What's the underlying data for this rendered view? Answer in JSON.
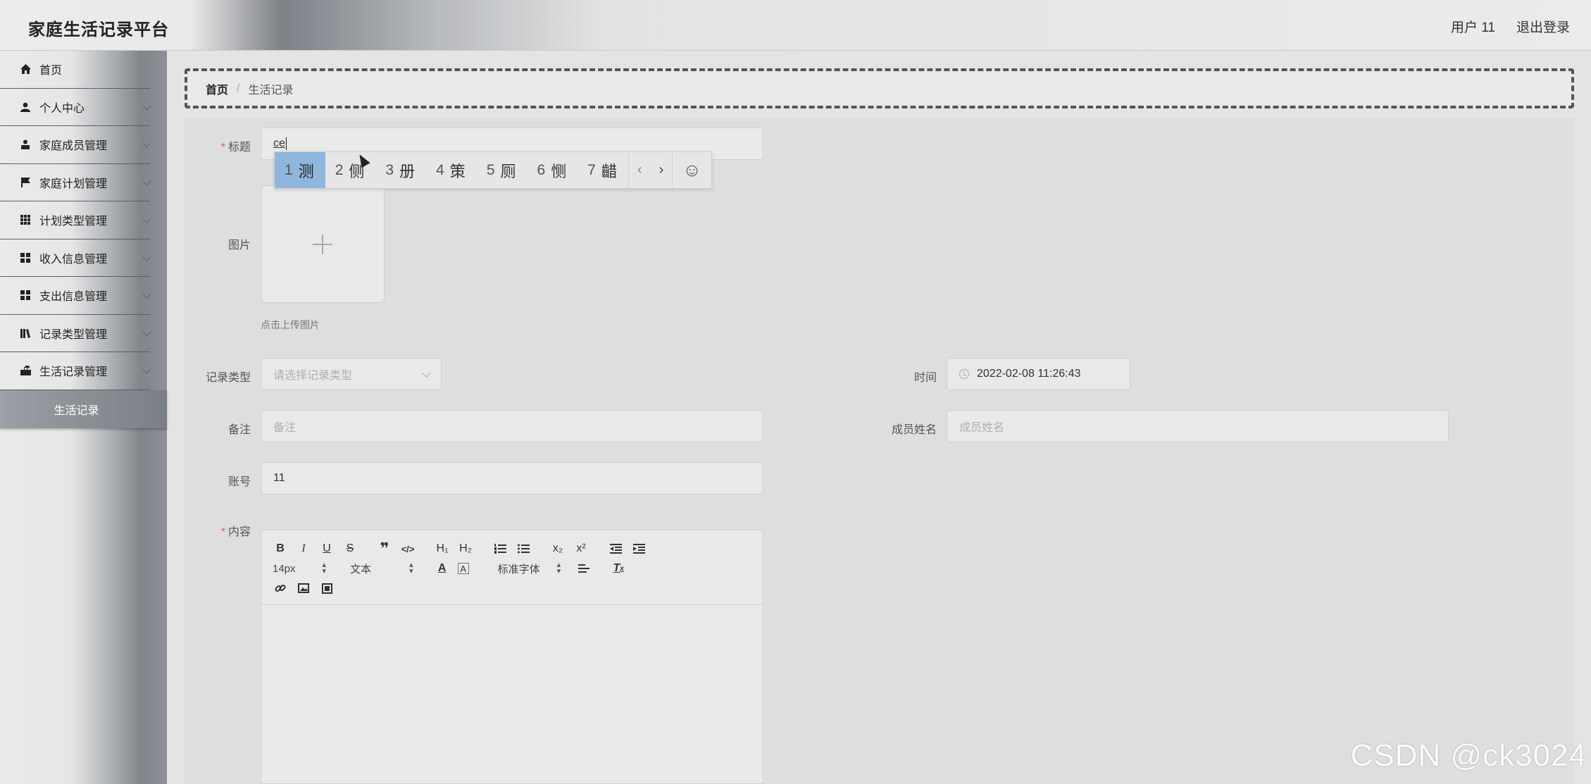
{
  "header": {
    "title": "家庭生活记录平台",
    "user": "用户 11",
    "logout": "退出登录"
  },
  "sidebar": {
    "items": [
      {
        "label": "首页",
        "icon": "home-icon"
      },
      {
        "label": "个人中心",
        "icon": "user-icon"
      },
      {
        "label": "家庭成员管理",
        "icon": "person-icon"
      },
      {
        "label": "家庭计划管理",
        "icon": "flag-icon"
      },
      {
        "label": "计划类型管理",
        "icon": "grid-icon"
      },
      {
        "label": "收入信息管理",
        "icon": "apps-icon"
      },
      {
        "label": "支出信息管理",
        "icon": "apps-icon"
      },
      {
        "label": "记录类型管理",
        "icon": "books-icon"
      },
      {
        "label": "生活记录管理",
        "icon": "briefcase-icon"
      }
    ],
    "active_sub": "生活记录"
  },
  "breadcrumb": {
    "home": "首页",
    "separator": "/",
    "current": "生活记录"
  },
  "form": {
    "title_label": "标题",
    "title_value": "ce",
    "image_label": "图片",
    "upload_tip": "点击上传图片",
    "record_type_label": "记录类型",
    "record_type_placeholder": "请选择记录类型",
    "time_label": "时间",
    "time_value": "2022-02-08 11:26:43",
    "remark_label": "备注",
    "remark_placeholder": "备注",
    "member_label": "成员姓名",
    "member_placeholder": "成员姓名",
    "account_label": "账号",
    "account_value": "11",
    "content_label": "内容"
  },
  "ime": {
    "candidates": [
      {
        "num": "1",
        "text": "测"
      },
      {
        "num": "2",
        "text": "侧"
      },
      {
        "num": "3",
        "text": "册"
      },
      {
        "num": "4",
        "text": "策"
      },
      {
        "num": "5",
        "text": "厕"
      },
      {
        "num": "6",
        "text": "恻"
      },
      {
        "num": "7",
        "text": "齰"
      }
    ],
    "prev": "‹",
    "next": "›",
    "emoji": "☺"
  },
  "editor": {
    "font_size": "14px",
    "format": "文本",
    "font_family": "标准字体",
    "h1": "H₁",
    "h2": "H₂",
    "sub": "x₂",
    "sup": "x²"
  },
  "watermark": "CSDN @ck3024"
}
